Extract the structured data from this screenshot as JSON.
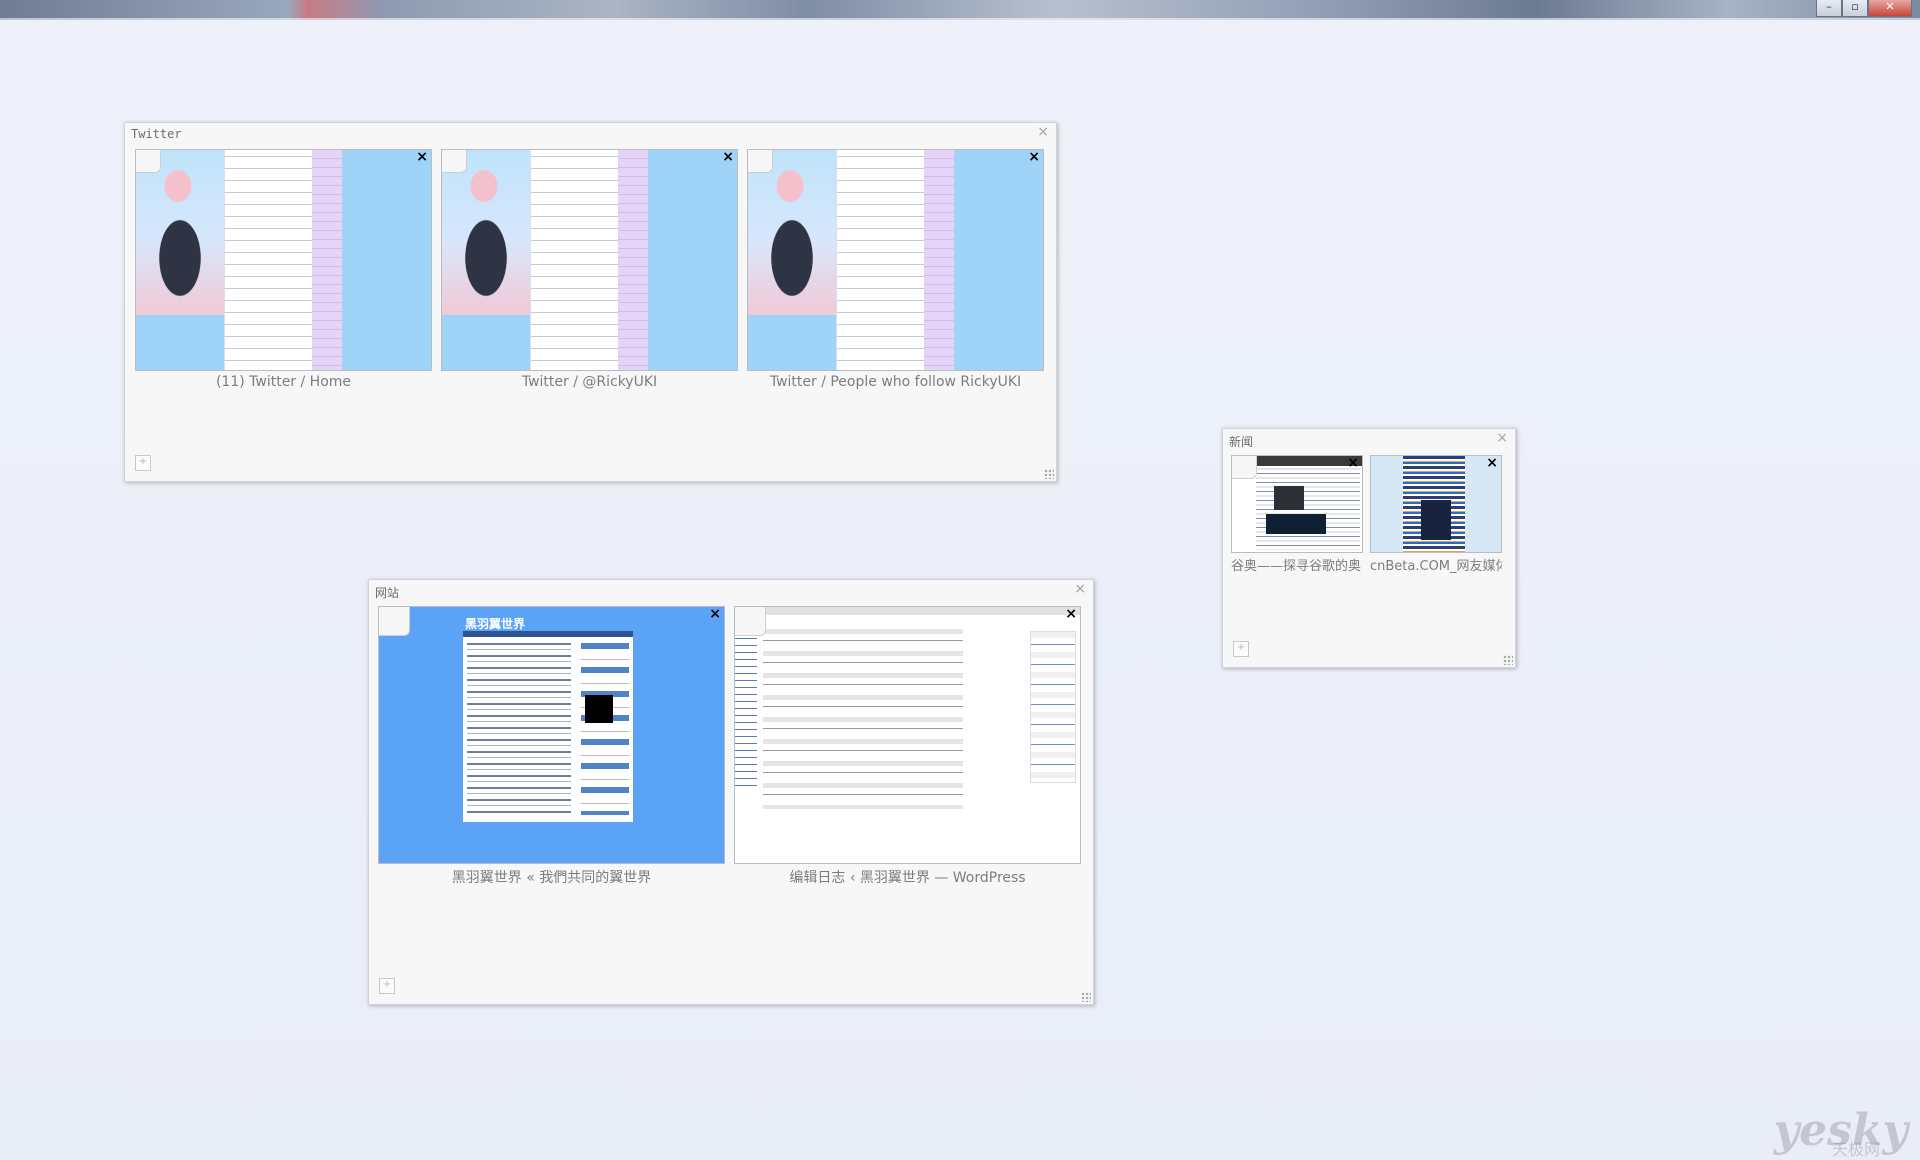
{
  "window": {
    "controls": {
      "minimize": "–",
      "maximize": "▫",
      "close": "✕"
    }
  },
  "groups": [
    {
      "title": "Twitter",
      "tabs": [
        {
          "label": "(11) Twitter / Home"
        },
        {
          "label": "Twitter / @RickyUKI"
        },
        {
          "label": "Twitter / People who follow RickyUKI"
        }
      ]
    },
    {
      "title": "新闻",
      "tabs": [
        {
          "label": "谷奥——探寻谷歌的奥"
        },
        {
          "label": "cnBeta.COM_网友媒体"
        }
      ]
    },
    {
      "title": "网站",
      "tabs": [
        {
          "label": "黑羽翼世界 « 我們共同的翼世界",
          "thumb_title": "黑羽翼世界"
        },
        {
          "label": "编辑日志 ‹ 黑羽翼世界 — WordPress"
        }
      ]
    }
  ],
  "icons": {
    "close_tab": "×",
    "close_group": "×",
    "add_tab": "+"
  },
  "watermark": {
    "brand": "yesky",
    "sub": "天极网"
  }
}
